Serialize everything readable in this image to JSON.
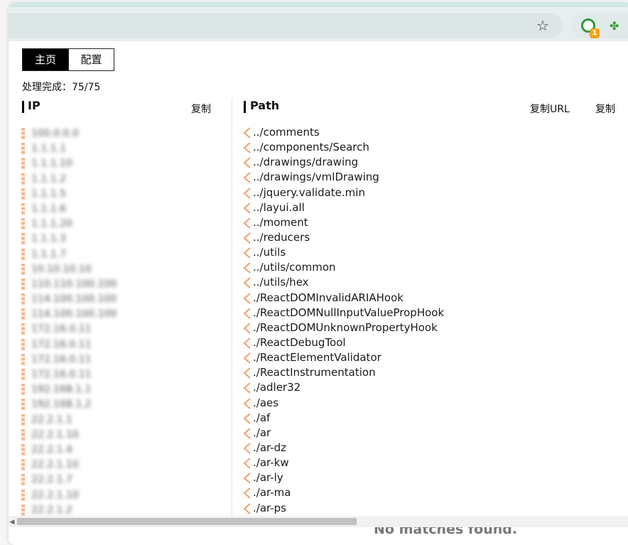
{
  "browser": {
    "star_icon": "star-icon",
    "extension_badge": "1",
    "accent": "#2e9a3b"
  },
  "tabs": [
    {
      "label": "主页",
      "active": true
    },
    {
      "label": "配置",
      "active": false
    }
  ],
  "status": "处理完成：75/75",
  "ip_panel": {
    "title": "IP",
    "copy_label": "复制",
    "items": [
      "100.0.0.0",
      "1.1.1.1",
      "1.1.1.10",
      "1.1.1.2",
      "1.1.1.5",
      "1.1.1.6",
      "1.1.1.20",
      "1.1.1.3",
      "1.1.1.7",
      "10.10.10.10",
      "110.110.100.100",
      "114.100.100.100",
      "114.100.100.100",
      "172.16.0.11",
      "172.16.0.11",
      "172.16.0.11",
      "172.16.0.11",
      "192.168.1.1",
      "192.168.1.2",
      "22.2.1.1",
      "22.2.1.10",
      "22.2.1.4",
      "22.2.1.10",
      "22.2.1.7",
      "22.2.1.10",
      "22.2.1.2"
    ]
  },
  "path_panel": {
    "title": "Path",
    "copy_url_label": "复制URL",
    "copy_label": "复制",
    "items": [
      "../comments",
      "../components/Search",
      "../drawings/drawing",
      "../drawings/vmlDrawing",
      "../jquery.validate.min",
      "../layui.all",
      "../moment",
      "../reducers",
      "../utils",
      "../utils/common",
      "../utils/hex",
      "./ReactDOMInvalidARIAHook",
      "./ReactDOMNullInputValuePropHook",
      "./ReactDOMUnknownPropertyHook",
      "./ReactDebugTool",
      "./ReactElementValidator",
      "./ReactInstrumentation",
      "./adler32",
      "./aes",
      "./af",
      "./ar",
      "./ar-dz",
      "./ar-kw",
      "./ar-ly",
      "./ar-ma",
      "./ar-ps"
    ]
  },
  "footer": {
    "no_matches": "No matches found."
  }
}
